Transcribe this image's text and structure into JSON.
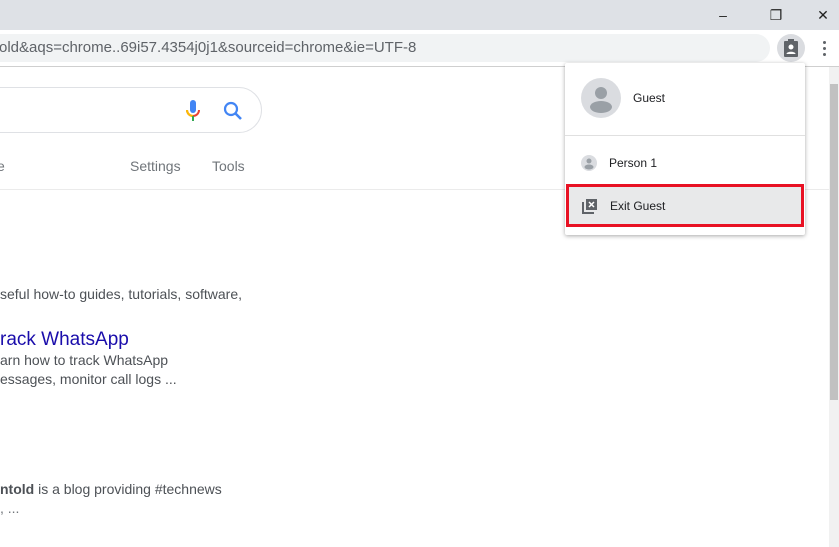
{
  "window": {
    "minimize": "–",
    "restore": "❐",
    "close": "✕"
  },
  "omnibox": {
    "url": "old&aqs=chrome..69i57.4354j0j1&sourceid=chrome&ie=UTF-8"
  },
  "tabs": {
    "partial": "e",
    "settings": "Settings",
    "tools": "Tools"
  },
  "results": [
    {
      "snippet1": "seful how-to guides, tutorials, software,"
    },
    {
      "title": "rack WhatsApp",
      "snippet1": "arn how to track WhatsApp",
      "snippet2": "essages, monitor call logs ..."
    },
    {
      "bold": "ntold",
      "snippet1": " is a blog providing #technews",
      "snippet2": ", ..."
    }
  ],
  "profile_menu": {
    "current": "Guest",
    "items": [
      {
        "label": "Person 1",
        "icon": "person-icon"
      },
      {
        "label": "Exit Guest",
        "icon": "exit-guest-icon"
      }
    ]
  },
  "colors": {
    "highlight": "#e81123",
    "link": "#1a0dab"
  }
}
